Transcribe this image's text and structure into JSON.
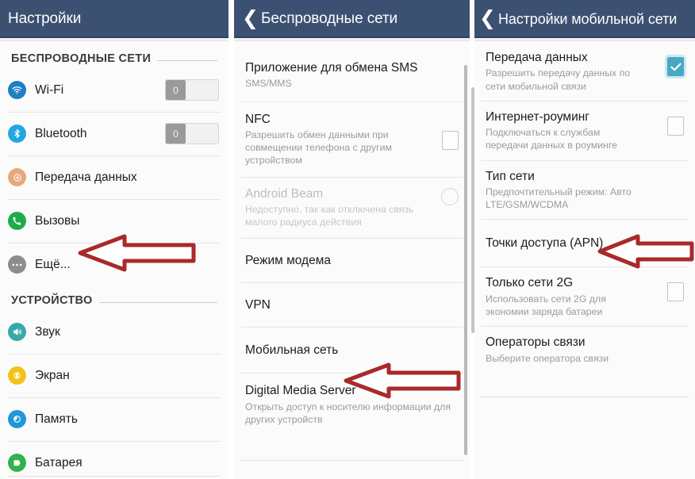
{
  "theme": {
    "appbar_bg": "#3c5172",
    "appbar_text": "#ffffff",
    "panel_bg": "#fbfbfb",
    "title_text": "#1c1c1c",
    "subtitle_text": "#9b9b9b",
    "divider": "#e6e6e6",
    "checkbox_checked": "#4aa8c4",
    "annotation_arrow": "#a82a2a"
  },
  "panels": {
    "settings": {
      "appbar": {
        "title": "Настройки",
        "has_back": false
      },
      "sections": [
        {
          "header": "БЕСПРОВОДНЫЕ СЕТИ",
          "items": [
            {
              "label": "Wi-Fi",
              "icon": "wifi-icon",
              "icon_color": "#1d7fc4",
              "control": "switch",
              "switch_state": "off",
              "switch_glyph": "0"
            },
            {
              "label": "Bluetooth",
              "icon": "bluetooth-icon",
              "icon_color": "#22a8e0",
              "control": "switch",
              "switch_state": "off",
              "switch_glyph": "0"
            },
            {
              "label": "Передача данных",
              "icon": "data-usage-icon",
              "icon_color": "#e8a87c",
              "control": "none"
            },
            {
              "label": "Вызовы",
              "icon": "phone-icon",
              "icon_color": "#1eab4b",
              "control": "none"
            },
            {
              "label": "Ещё...",
              "icon": "more-dots-icon",
              "icon_color": "#8d8d8d",
              "control": "none"
            }
          ]
        },
        {
          "header": "УСТРОЙСТВО",
          "items": [
            {
              "label": "Звук",
              "icon": "sound-icon",
              "icon_color": "#3aa8a8",
              "control": "none"
            },
            {
              "label": "Экран",
              "icon": "display-icon",
              "icon_color": "#f0c419",
              "control": "none"
            },
            {
              "label": "Память",
              "icon": "storage-icon",
              "icon_color": "#2196d8",
              "control": "none"
            },
            {
              "label": "Батарея",
              "icon": "battery-icon",
              "icon_color": "#33b24a",
              "control": "none"
            }
          ]
        }
      ]
    },
    "wireless": {
      "appbar": {
        "title": "Беспроводные сети",
        "has_back": true,
        "back_glyph": "❮"
      },
      "items": [
        {
          "title": "Приложение для обмена SMS",
          "subtitle": "SMS/MMS",
          "control": "none",
          "disabled": false
        },
        {
          "title": "NFC",
          "subtitle": "Разрешить обмен данными при совмещении телефона с другим устройством",
          "control": "checkbox",
          "checked": false,
          "disabled": false
        },
        {
          "title": "Android Beam",
          "subtitle": "Недоступно, так как отключена связь малого радиуса действия",
          "control": "circle",
          "checked": false,
          "disabled": true
        },
        {
          "title": "Режим модема",
          "subtitle": "",
          "control": "none",
          "disabled": false
        },
        {
          "title": "VPN",
          "subtitle": "",
          "control": "none",
          "disabled": false
        },
        {
          "title": "Мобильная сеть",
          "subtitle": "",
          "control": "none",
          "disabled": false
        },
        {
          "title": "Digital Media Server",
          "subtitle": "Открыть доступ к носителю информации для других устройств",
          "control": "none",
          "disabled": false
        }
      ]
    },
    "mobile": {
      "appbar": {
        "title": "Настройки мобильной сети",
        "has_back": true,
        "back_glyph": "❮"
      },
      "items": [
        {
          "title": "Передача данных",
          "subtitle": "Разрешить передачу данных по сети мобильной связи",
          "control": "checkbox",
          "checked": true
        },
        {
          "title": "Интернет-роуминг",
          "subtitle": "Подключаться к службам передачи данных в роуминге",
          "control": "checkbox",
          "checked": false
        },
        {
          "title": "Тип сети",
          "subtitle": "Предпочтительный режим: Авто LTE/GSM/WCDMA",
          "control": "none"
        },
        {
          "title": "Точки доступа (APN)",
          "subtitle": "",
          "control": "none"
        },
        {
          "title": "Только сети 2G",
          "subtitle": "Использовать сети 2G для экономии заряда батареи",
          "control": "checkbox",
          "checked": false
        },
        {
          "title": "Операторы связи",
          "subtitle": "Выберите оператора связи",
          "control": "none"
        }
      ]
    }
  },
  "annotations": [
    {
      "name": "arrow-to-more",
      "points_to": "Ещё...",
      "direction": "left"
    },
    {
      "name": "arrow-to-mobile-net",
      "points_to": "Мобильная сеть",
      "direction": "left"
    },
    {
      "name": "arrow-to-apn",
      "points_to": "Точки доступа (APN)",
      "direction": "left"
    }
  ]
}
